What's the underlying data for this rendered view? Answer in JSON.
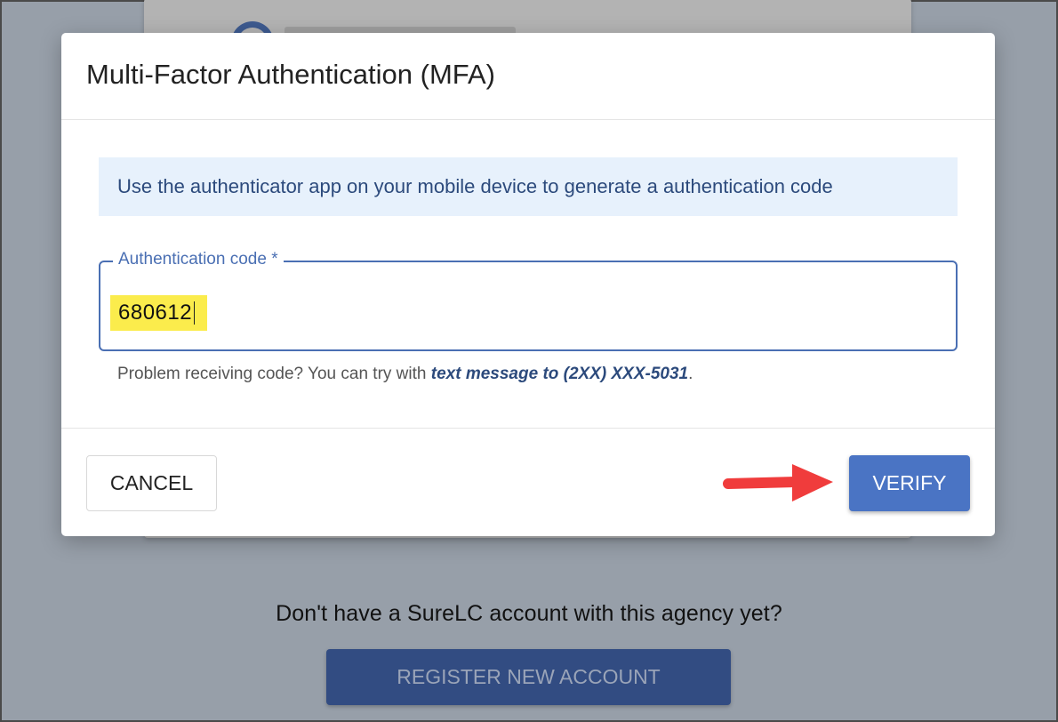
{
  "background": {
    "question": "Don't have a SureLC account with this agency yet?",
    "register_label": "REGISTER NEW ACCOUNT"
  },
  "modal": {
    "title": "Multi-Factor Authentication (MFA)",
    "info": "Use the authenticator app on your mobile device to generate a authentication code",
    "field": {
      "label": "Authentication code",
      "required_marker": "*",
      "value": "680612"
    },
    "help": {
      "prefix": "Problem receiving code? You can try with ",
      "link": "text message to (2XX) XXX-5031",
      "suffix": "."
    },
    "cancel_label": "CANCEL",
    "verify_label": "VERIFY"
  },
  "colors": {
    "accent": "#4a74c4",
    "annotation_arrow": "#f03c3c",
    "highlight": "#fbec4c"
  },
  "annotation": {
    "arrow_icon": "red-arrow-right-icon"
  }
}
